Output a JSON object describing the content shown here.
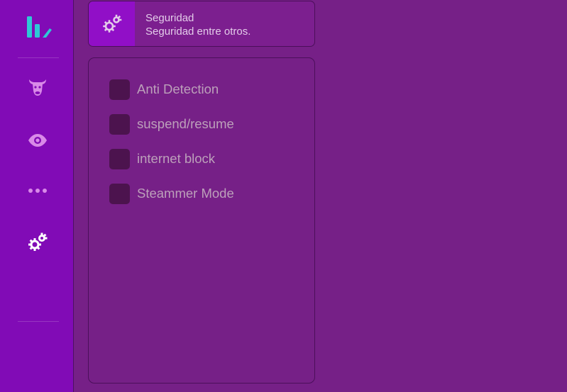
{
  "colors": {
    "sidebar_bg": "#810bb6",
    "main_bg": "#762087",
    "accent": "#910fc7",
    "logo": "#2ec8d6",
    "icon": "#d98ae8",
    "icon_active": "#ffffff",
    "checkbox": "#4c134e",
    "label": "#bca0ba"
  },
  "sidebar": {
    "logo_icon": "bar-chart-logo-icon",
    "items": [
      {
        "name": "bull-icon",
        "active": false
      },
      {
        "name": "eye-icon",
        "active": false
      },
      {
        "name": "more-icon",
        "active": false
      },
      {
        "name": "gears-icon",
        "active": true
      }
    ]
  },
  "header": {
    "icon": "gears-icon",
    "title": "Seguridad",
    "subtitle": "Seguridad entre otros."
  },
  "options": [
    {
      "label": "Anti Detection",
      "checked": false
    },
    {
      "label": "suspend/resume",
      "checked": false
    },
    {
      "label": "internet block",
      "checked": false
    },
    {
      "label": "Steammer Mode",
      "checked": false
    }
  ]
}
